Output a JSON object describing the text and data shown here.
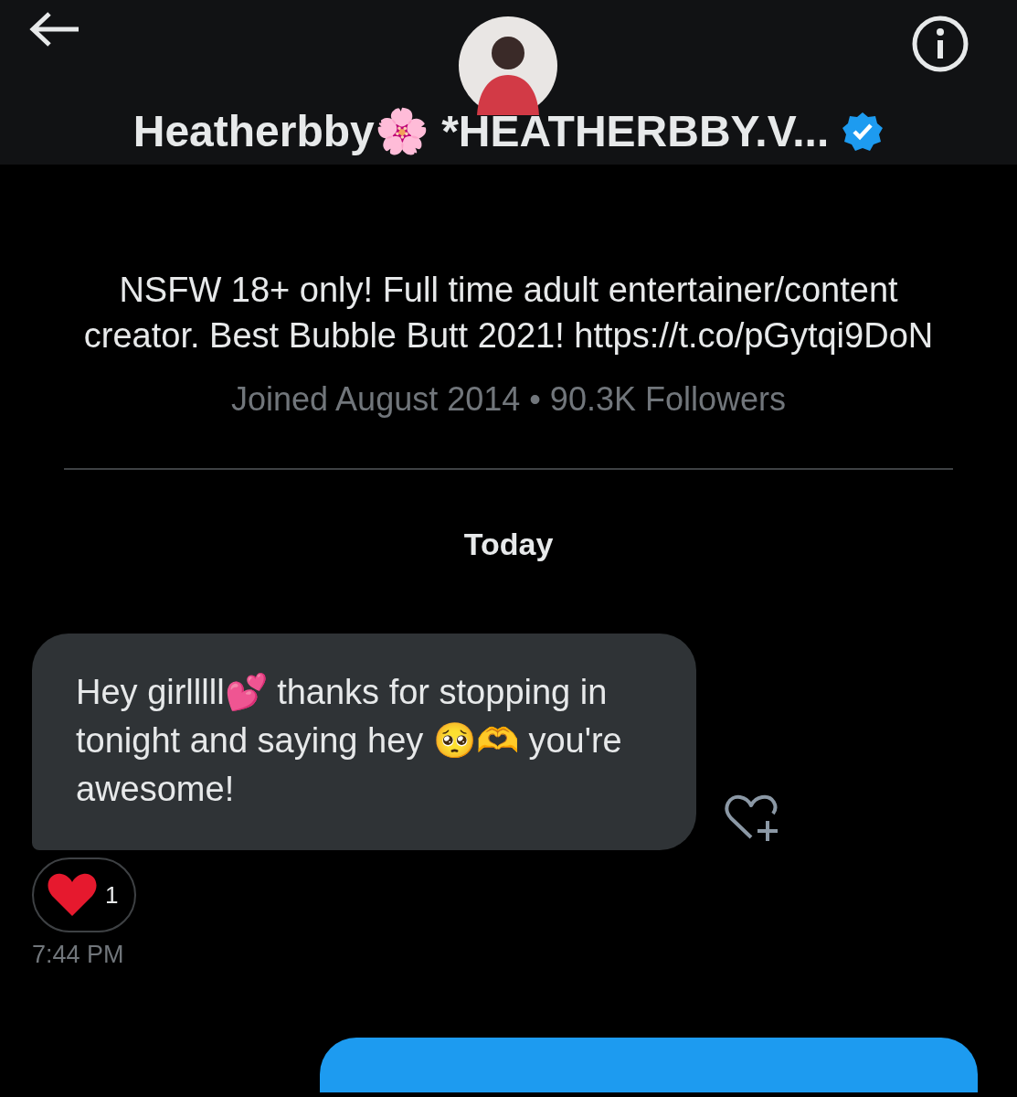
{
  "header": {
    "title": "Heatherbby🌸 *HEATHERBBY.V...",
    "verified": true
  },
  "profile": {
    "bio": "NSFW 18+ only! Full time adult entertainer/content creator. Best Bubble Butt 2021! https://t.co/pGytqi9DoN",
    "meta": "Joined August 2014 • 90.3K Followers"
  },
  "day_label": "Today",
  "messages": [
    {
      "kind": "received",
      "text": "Hey girlllll💕 thanks for stopping in tonight and saying hey 🥺🫶 you're awesome!",
      "reaction_count": "1",
      "time": "7:44 PM"
    },
    {
      "kind": "sent"
    }
  ]
}
